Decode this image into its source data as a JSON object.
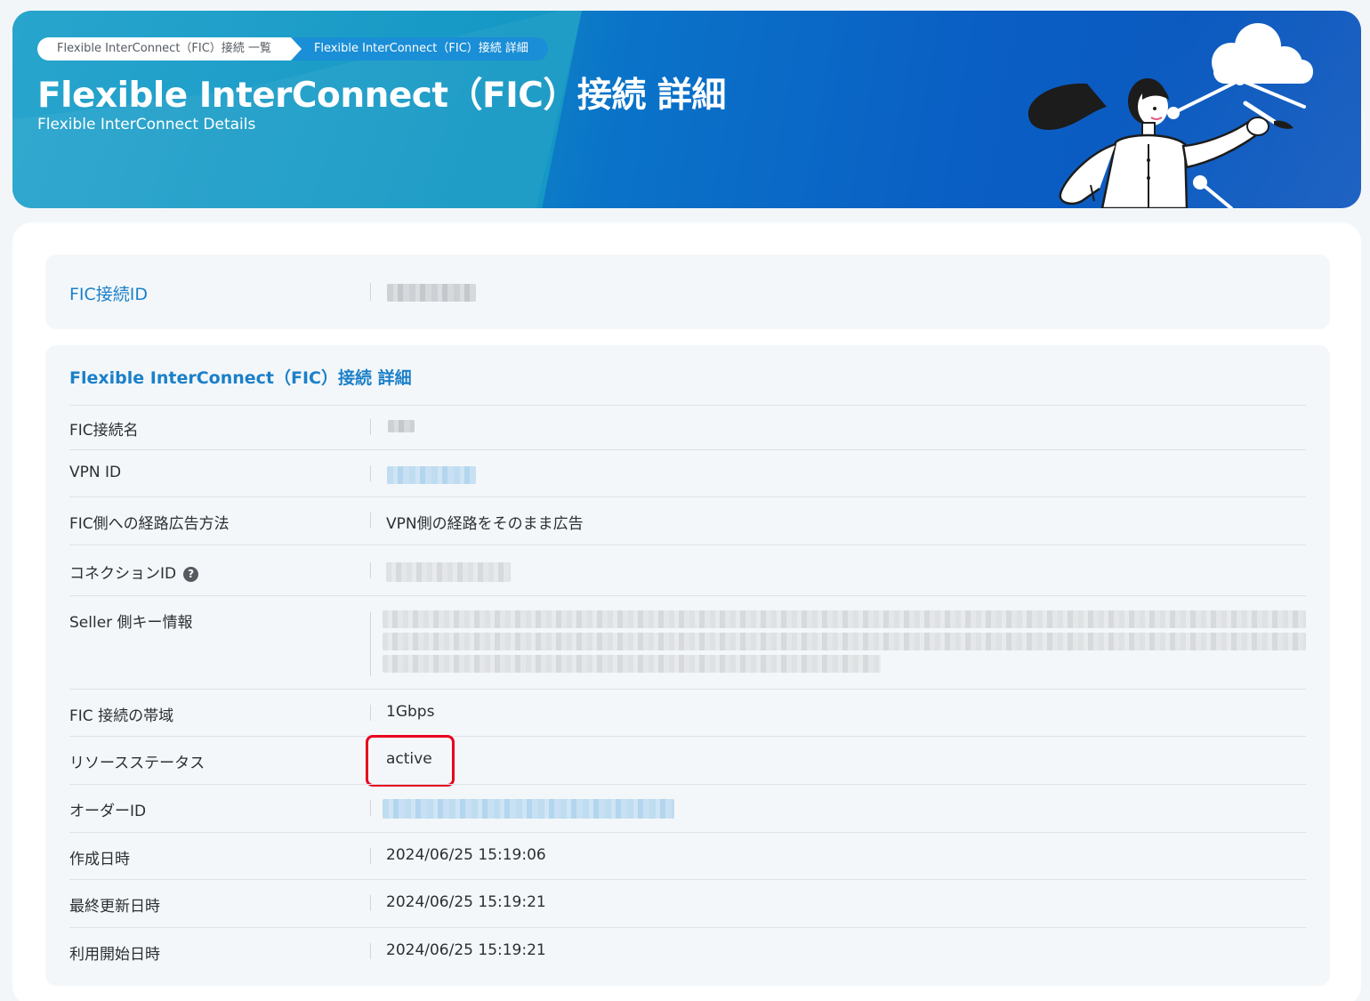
{
  "breadcrumb": {
    "items": [
      {
        "label": "Flexible InterConnect（FIC）接続 一覧"
      },
      {
        "label": "Flexible InterConnect（FIC）接続 詳細"
      }
    ]
  },
  "hero": {
    "title": "Flexible InterConnect（FIC）接続 詳細",
    "subtitle": "Flexible InterConnect Details"
  },
  "id_panel": {
    "label": "FIC接続ID",
    "value_redacted": true
  },
  "details": {
    "section_title": "Flexible InterConnect（FIC）接続 詳細",
    "rows": [
      {
        "label": "FIC接続名",
        "value": "",
        "redacted": true
      },
      {
        "label": "VPN ID",
        "value": "",
        "redacted": true
      },
      {
        "label": "FIC側への経路広告方法",
        "value": "VPN側の経路をそのまま広告"
      },
      {
        "label": "コネクションID",
        "value": "",
        "redacted": true,
        "help_icon": "?"
      },
      {
        "label": "Seller 側キー情報",
        "value": "",
        "redacted": true
      },
      {
        "label": "FIC 接続の帯域",
        "value": "1Gbps"
      },
      {
        "label": "リソースステータス",
        "value": "active",
        "highlighted": true
      },
      {
        "label": "オーダーID",
        "value": "",
        "redacted": true
      },
      {
        "label": "作成日時",
        "value": "2024/06/25 15:19:06"
      },
      {
        "label": "最終更新日時",
        "value": "2024/06/25 15:19:21"
      },
      {
        "label": "利用開始日時",
        "value": "2024/06/25 15:19:21"
      }
    ]
  },
  "colors": {
    "accent_link": "#1b80c8",
    "highlight": "#e8001d",
    "hero_blue": "#0a5fc4"
  }
}
